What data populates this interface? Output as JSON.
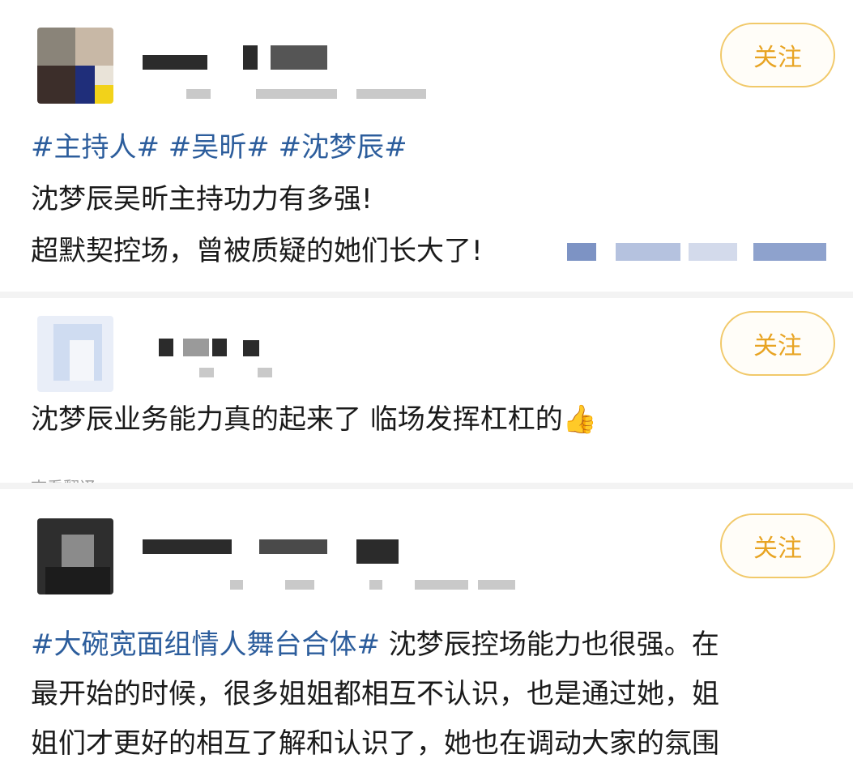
{
  "follow_label": "关注",
  "posts": [
    {
      "hashtags": [
        "#主持人#",
        "#吴昕#",
        "#沈梦辰#"
      ],
      "lines": [
        "沈梦辰吴昕主持功力有多强!",
        "超默契控场，曾被质疑的她们长大了!"
      ]
    },
    {
      "lines": [
        "沈梦辰业务能力真的起来了 临场发挥杠杠的"
      ],
      "emoji": "👍",
      "cut_text": "查看翻译"
    },
    {
      "hashtag": "#大碗宽面组情人舞台合体#",
      "lines": [
        "沈梦辰控场能力也很强。在",
        "最开始的时候，很多姐姐都相互不认识，也是通过她，姐",
        "姐们才更好的相互了解和认识了，她也在调动大家的氛围"
      ]
    }
  ],
  "colors": {
    "hashtag": "#2c5d9c",
    "follow_text": "#e8a423",
    "follow_border": "#f1c96a"
  },
  "icons": {
    "thumbs_up": "thumbs-up-emoji"
  }
}
